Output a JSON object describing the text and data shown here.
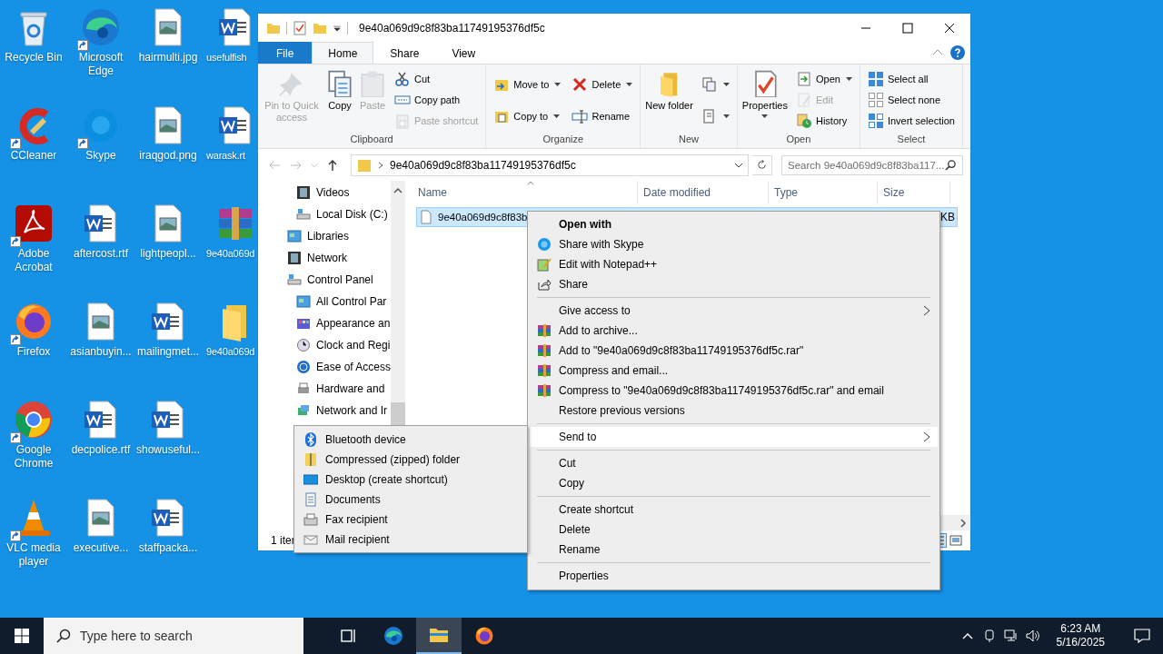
{
  "desktop": {
    "icons": [
      {
        "label": "Recycle Bin",
        "kind": "recycle",
        "shortcut": false
      },
      {
        "label": "CCleaner",
        "kind": "cleaner",
        "shortcut": true
      },
      {
        "label": "Adobe Acrobat",
        "kind": "pdf",
        "shortcut": true
      },
      {
        "label": "Firefox",
        "kind": "firefox",
        "shortcut": true
      },
      {
        "label": "Google Chrome",
        "kind": "chrome",
        "shortcut": true
      },
      {
        "label": "VLC media player",
        "kind": "cone",
        "shortcut": true
      },
      {
        "label": "Microsoft Edge",
        "kind": "edge",
        "shortcut": true
      },
      {
        "label": "Skype",
        "kind": "chat",
        "shortcut": true
      },
      {
        "label": "aftercost.rtf",
        "kind": "word",
        "shortcut": false
      },
      {
        "label": "asianbuyin...",
        "kind": "image",
        "shortcut": false
      },
      {
        "label": "decpolice.rtf",
        "kind": "word",
        "shortcut": false
      },
      {
        "label": "executive...",
        "kind": "image",
        "shortcut": false
      },
      {
        "label": "hairmulti.jpg",
        "kind": "image",
        "shortcut": false
      },
      {
        "label": "iraqgod.png",
        "kind": "image",
        "shortcut": false
      },
      {
        "label": "lightpeopl...",
        "kind": "image",
        "shortcut": false
      },
      {
        "label": "mailingmet...",
        "kind": "word",
        "shortcut": false
      },
      {
        "label": "showuseful...",
        "kind": "word",
        "shortcut": false
      },
      {
        "label": "staffpacka...",
        "kind": "word",
        "shortcut": false
      },
      {
        "label": "usefulfish",
        "kind": "word",
        "shortcut": false
      },
      {
        "label": "warask.rt",
        "kind": "word",
        "shortcut": false
      },
      {
        "label": "9e40a069d",
        "kind": "archive",
        "shortcut": false
      },
      {
        "label": "9e40a069d",
        "kind": "folder",
        "shortcut": false
      }
    ]
  },
  "explorer": {
    "title": "9e40a069d9c8f83ba11749195376df5c",
    "tabs": [
      {
        "label": "File",
        "kind": "file",
        "selected": false
      },
      {
        "label": "Home",
        "kind": "tab",
        "selected": true
      },
      {
        "label": "Share",
        "kind": "tab",
        "selected": false
      },
      {
        "label": "View",
        "kind": "tab",
        "selected": false
      }
    ],
    "ribbon_groups": [
      {
        "label": "Clipboard",
        "commands": [
          {
            "label": "Pin to Quick access",
            "kind": "large",
            "disabled": true
          },
          {
            "label": "Copy",
            "kind": "large",
            "disabled": false
          },
          {
            "label": "Paste",
            "kind": "large",
            "disabled": true
          },
          {
            "kind": "column",
            "items": [
              {
                "label": "Cut",
                "disabled": false,
                "dropdown": false
              },
              {
                "label": "Copy path",
                "disabled": false,
                "dropdown": false
              },
              {
                "label": "Paste shortcut",
                "disabled": true,
                "dropdown": false
              }
            ]
          }
        ]
      },
      {
        "label": "Organize",
        "commands": [
          {
            "kind": "column",
            "items": [
              {
                "label": "Move to",
                "disabled": false,
                "dropdown": true
              },
              {
                "label": "Copy to",
                "disabled": false,
                "dropdown": true
              }
            ]
          },
          {
            "kind": "column",
            "items": [
              {
                "label": "Delete",
                "disabled": false,
                "dropdown": true
              },
              {
                "label": "Rename",
                "disabled": false,
                "dropdown": false
              }
            ]
          }
        ]
      },
      {
        "label": "New",
        "commands": [
          {
            "label": "New folder",
            "kind": "large",
            "disabled": false
          },
          {
            "kind": "column",
            "items": [
              {
                "disabled": false,
                "dropdown": true
              },
              {
                "disabled": false,
                "dropdown": true
              }
            ]
          }
        ]
      },
      {
        "label": "Open",
        "commands": [
          {
            "label": "Properties",
            "kind": "large",
            "disabled": false,
            "dropdown": true
          },
          {
            "kind": "column",
            "items": [
              {
                "label": "Open",
                "disabled": false,
                "dropdown": true
              },
              {
                "label": "Edit",
                "disabled": true,
                "dropdown": false
              },
              {
                "label": "History",
                "disabled": false,
                "dropdown": false
              }
            ]
          }
        ]
      },
      {
        "label": "Select",
        "commands": [
          {
            "kind": "column",
            "items": [
              {
                "label": "Select all",
                "disabled": false,
                "dropdown": false
              },
              {
                "label": "Select none",
                "disabled": false,
                "dropdown": false
              },
              {
                "label": "Invert selection",
                "disabled": false,
                "dropdown": false
              }
            ]
          }
        ]
      }
    ],
    "address": "9e40a069d9c8f83ba11749195376df5c",
    "search": {
      "placeholder": "Search 9e40a069d9c8f83ba117..."
    },
    "nav": [
      {
        "children": [
          {
            "label": "Videos"
          },
          {
            "label": "Local Disk (C:)"
          }
        ]
      },
      {
        "label": "Libraries"
      },
      {
        "label": "Network"
      },
      {
        "label": "Control Panel",
        "children": [
          {
            "label": "All Control Par"
          },
          {
            "label": "Appearance an"
          },
          {
            "label": "Clock and Regi"
          },
          {
            "label": "Ease of Access"
          },
          {
            "label": "Hardware and"
          },
          {
            "label": "Network and Ir"
          }
        ]
      }
    ],
    "columns": [
      "Name",
      "Date modified",
      "Type",
      "Size"
    ],
    "files": [
      {
        "name": "9e40a069d9c8f83b",
        "size": "KB",
        "selected": true
      }
    ],
    "status": "1 iter"
  },
  "context_menu": {
    "items": [
      {
        "kind": "item",
        "label": "Open with",
        "bold": true
      },
      {
        "kind": "item",
        "label": "Share with Skype"
      },
      {
        "kind": "item",
        "label": "Edit with Notepad++"
      },
      {
        "kind": "item",
        "label": "Share"
      },
      {
        "kind": "separator"
      },
      {
        "kind": "submenu",
        "label": "Give access to"
      },
      {
        "kind": "item",
        "label": "Add to archive..."
      },
      {
        "kind": "item",
        "label": "Add to \"9e40a069d9c8f83ba11749195376df5c.rar\""
      },
      {
        "kind": "item",
        "label": "Compress and email..."
      },
      {
        "kind": "item",
        "label": "Compress to \"9e40a069d9c8f83ba11749195376df5c.rar\" and email"
      },
      {
        "kind": "item",
        "label": "Restore previous versions"
      },
      {
        "kind": "separator"
      },
      {
        "kind": "submenu",
        "label": "Send to",
        "selected": true
      },
      {
        "kind": "separator"
      },
      {
        "kind": "item",
        "label": "Cut"
      },
      {
        "kind": "item",
        "label": "Copy"
      },
      {
        "kind": "separator"
      },
      {
        "kind": "item",
        "label": "Create shortcut"
      },
      {
        "kind": "item",
        "label": "Delete"
      },
      {
        "kind": "item",
        "label": "Rename"
      },
      {
        "kind": "separator"
      },
      {
        "kind": "item",
        "label": "Properties"
      }
    ]
  },
  "send_to_menu": {
    "items": [
      "Bluetooth device",
      "Compressed (zipped) folder",
      "Desktop (create shortcut)",
      "Documents",
      "Fax recipient",
      "Mail recipient"
    ]
  },
  "taskbar": {
    "search_placeholder": "Type here to search",
    "apps": [
      {
        "kind": "taskview",
        "selected": false
      },
      {
        "kind": "edge",
        "selected": false
      },
      {
        "kind": "explorer",
        "selected": true
      },
      {
        "kind": "firefox",
        "selected": false
      }
    ],
    "time": "6:23 AM",
    "date": "5/16/2025"
  }
}
